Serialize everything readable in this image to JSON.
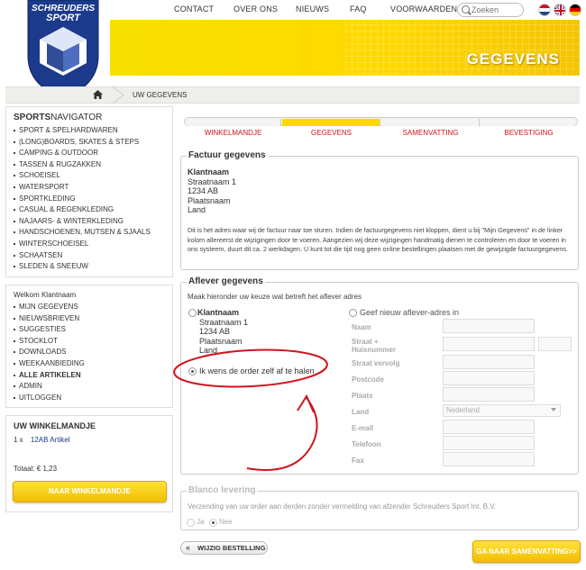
{
  "nav": {
    "items": [
      "CONTACT",
      "OVER ONS",
      "NIEUWS",
      "FAQ",
      "VOORWAARDEN"
    ],
    "search_placeholder": "Zoeken"
  },
  "logo": {
    "line1": "SCHREUDERS",
    "line2": "SPORT"
  },
  "banner": {
    "title": "GEGEVENS"
  },
  "breadcrumb": {
    "current": "UW GEGEVENS"
  },
  "sidebar": {
    "nav_title_bold": "SPORTS",
    "nav_title_rest": "NAVIGATOR",
    "nav_items": [
      "SPORT & SPELHARDWAREN",
      "(LONG)BOARDS, SKATES & STEPS",
      "CAMPING & OUTDOOR",
      "TASSEN & RUGZAKKEN",
      "SCHOEISEL",
      "WATERSPORT",
      "SPORTKLEDING",
      "CASUAL & REGENKLEDING",
      "NAJAARS- & WINTERKLEDING",
      "HANDSCHOENEN, MUTSEN & SJAALS",
      "WINTERSCHOEISEL",
      "SCHAATSEN",
      "SLEDEN & SNEEUW"
    ],
    "welcome": "Welkom Klantnaam",
    "user_items": [
      "MIJN GEGEVENS",
      "NIEUWSBRIEVEN",
      "SUGGESTIES",
      "STOCKLOT",
      "DOWNLOADS",
      "WEEKAANBIEDING",
      "ALLE ARTIKELEN",
      "ADMIN",
      "UITLOGGEN"
    ],
    "cart_title": "UW WINKELMANDJE",
    "cart_qty": "1 x",
    "cart_item": "12AB Artikel",
    "cart_total": "Totaal: € 1,23",
    "cart_button": "NAAR WINKELMANDJE"
  },
  "steps": {
    "labels": [
      "WINKELMANDJE",
      "GEGEVENS",
      "SAMENVATTING",
      "BEVESTIGING"
    ],
    "active_index": 1
  },
  "factuur": {
    "legend": "Factuur gegevens",
    "name": "Klantnaam",
    "street": "Straatnaam 1",
    "zip": "1234 AB",
    "city": "Plaatsnaam",
    "country": "Land",
    "info": "Dit is het adres waar wij de factuur naar toe sturen. Indien de factuurgegevens niet kloppen, dient u bij \"Mijn Gegevens\" in de linker kolom allereerst de wijzigingen door te voeren. Aangezien wij deze wijzigingen handmatig dienen te controleren en door te voeren in ons systeem, duurt dit ca. 2 werkdagen. U kunt tot die tijd nog geen online bestellingen plaatsen met de gewijzigde factuurgegevens."
  },
  "aflever": {
    "legend": "Aflever gegevens",
    "intro": "Maak hieronder uw keuze wat betreft het aflever adres",
    "name": "Klantnaam",
    "street": "Straatnaam 1",
    "zip": "1234 AB",
    "city": "Plaatsnaam",
    "country": "Land",
    "selfpick": "Ik wens de order zelf af te halen",
    "new_address": "Geef nieuw aflever-adres in",
    "fields": {
      "naam": "Naam",
      "straat": "Straat +",
      "huisnummer": "Huisnummer",
      "straat_vervolg": "Straat vervolg",
      "postcode": "Postcode",
      "plaats": "Plaats",
      "land": "Land",
      "email": "E-mail",
      "telefoon": "Telefoon",
      "fax": "Fax"
    },
    "land_value": "Nederland"
  },
  "blanco": {
    "legend": "Blanco levering",
    "desc": "Verzending van uw order aan derden zonder vermelding van afzender Schreuders Sport Int. B.V.",
    "ja": "Ja",
    "nee": "Nee"
  },
  "buttons": {
    "back": "WIJZIG BESTELLING",
    "next": "GA NAAR SAMENVATTING>>"
  },
  "colors": {
    "accent_red": "#d0141c",
    "brand_blue": "#1b3a8c",
    "yellow": "#ffd800"
  }
}
